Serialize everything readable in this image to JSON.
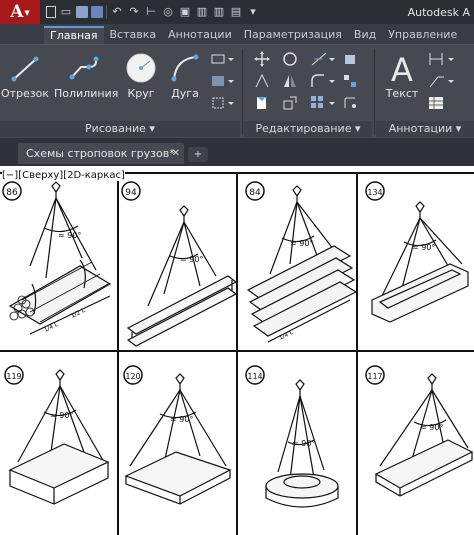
{
  "titlebar": {
    "app_logo": "A",
    "title": "Autodesk A"
  },
  "ribbon_tabs": [
    "Главная",
    "Вставка",
    "Аннотации",
    "Параметризация",
    "Вид",
    "Управление"
  ],
  "draw_panel": {
    "title": "Рисование ▾",
    "tools": [
      "Отрезок",
      "Полилиния",
      "Круг",
      "Дуга"
    ]
  },
  "modify_panel": {
    "title": "Редактирование ▾"
  },
  "annotation_panel": {
    "title": "Аннотации ▾",
    "tools": [
      "Текст"
    ]
  },
  "file_tab": {
    "label": "Схемы строповок грузов*"
  },
  "viewport": {
    "label": "[−][Сверху][2D-каркас]"
  },
  "drawing_cells": [
    "86",
    "94",
    "84",
    "134",
    "119",
    "120",
    "114",
    "117"
  ],
  "angle_labels": [
    "≈ 90°",
    "≈ 90°",
    "≈ 90°",
    "≈ 90°",
    "≈ 90°",
    "≈ 90°",
    "≈ 90°",
    "≈ 90°"
  ]
}
